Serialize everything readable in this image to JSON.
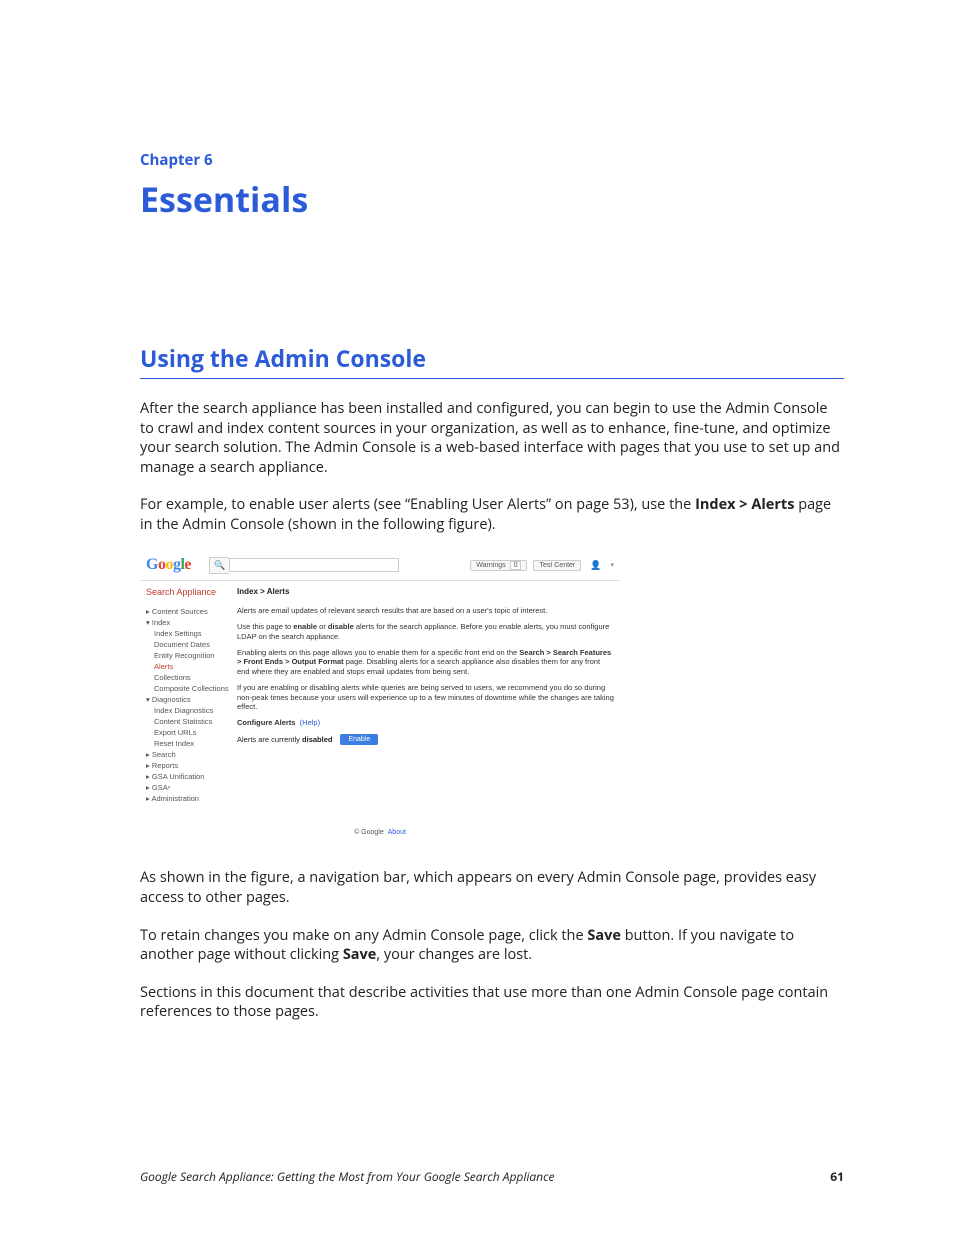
{
  "chapter": {
    "label": "Chapter 6",
    "title": "Essentials"
  },
  "section": {
    "title": "Using the Admin Console"
  },
  "paragraphs": {
    "p1": "After the search appliance has been installed and configured, you can begin to use the Admin Console to crawl and index content sources in your organization, as well as to enhance, fine-tune, and optimize your search solution. The Admin Console is a web-based interface with pages that you use to set up and manage a search appliance.",
    "p2a": "For example, to enable user alerts (see “Enabling User Alerts” on page 53), use the ",
    "p2b": "Index > Alerts",
    "p2c": " page in the Admin Console (shown in the following figure).",
    "p3": "As shown in the figure, a navigation bar, which appears on every Admin Console page, provides easy access to other pages.",
    "p4a": "To retain changes you make on any Admin Console page, click the ",
    "p4b": "Save",
    "p4c": " button. If you navigate to another page without clicking ",
    "p4d": "Save",
    "p4e": ", your changes are lost.",
    "p5": "Sections in this document that describe activities that use more than one Admin Console page contain references to those pages."
  },
  "console": {
    "logo": {
      "g1": "G",
      "o1": "o",
      "o2": "o",
      "g2": "g",
      "l": "l",
      "e": "e"
    },
    "warnings_label": "Warnings",
    "warnings_count": "0",
    "test_center": "Test Center",
    "app_title": "Search Appliance",
    "breadcrumb": "Index > Alerts",
    "sidebar": {
      "content_sources": "Content Sources",
      "index": "Index",
      "index_settings": "Index Settings",
      "document_dates": "Document Dates",
      "entity_recognition": "Entity Recognition",
      "alerts": "Alerts",
      "collections": "Collections",
      "composite_collections": "Composite Collections",
      "diagnostics": "Diagnostics",
      "index_diagnostics": "Index Diagnostics",
      "content_statistics": "Content Statistics",
      "export_urls": "Export URLs",
      "reset_index": "Reset Index",
      "search": "Search",
      "reports": "Reports",
      "gsa_unification": "GSA Unification",
      "gsan": "GSAⁿ",
      "administration": "Administration"
    },
    "content": {
      "line1": "Alerts are email updates of relevant search results that are based on a user's topic of interest.",
      "line2a": "Use this page to ",
      "line2b": "enable",
      "line2c": " or ",
      "line2d": "disable",
      "line2e": " alerts for the search appliance. Before you enable alerts, you must configure LDAP on the search appliance.",
      "line3a": "Enabling alerts on this page allows you to enable them for a specific front end on the ",
      "line3b": "Search > Search Features > Front Ends > Output Format",
      "line3c": " page. Disabling alerts for a search appliance also disables them for any front end where they are enabled and stops email updates from being sent.",
      "line4": "If you are enabling or disabling alerts while queries are being served to users, we recommend you do so during non-peak times because your users will experience up to a few minutes of downtime while the changes are taking effect.",
      "configure_label": "Configure Alerts",
      "help": "(Help)",
      "status_a": "Alerts are currently ",
      "status_b": "disabled",
      "enable_btn": "Enable"
    },
    "footer": {
      "copyright": "© Google",
      "about": "About"
    }
  },
  "footer": {
    "doc_title": "Google Search Appliance: Getting the Most from Your Google Search Appliance",
    "page_num": "61"
  }
}
